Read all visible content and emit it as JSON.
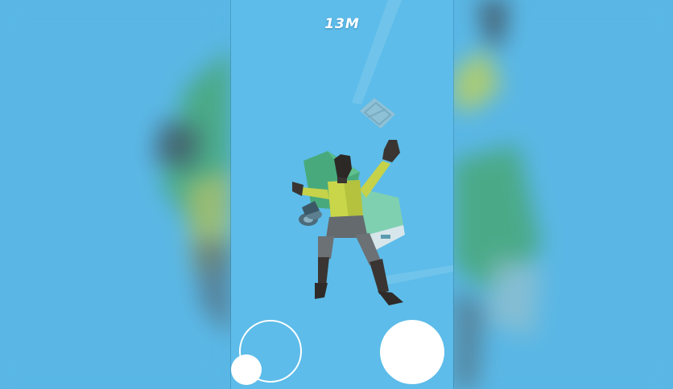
{
  "hud": {
    "distance": "13M"
  },
  "controls": {
    "joystick": "movement-joystick",
    "action": "action-button"
  },
  "colors": {
    "sky": "#5dbce9",
    "shirt": "#c9d64a",
    "crate": "#49ad7a",
    "skin": "#3a3532",
    "pants": "#5f6468",
    "ui": "#ffffff"
  }
}
